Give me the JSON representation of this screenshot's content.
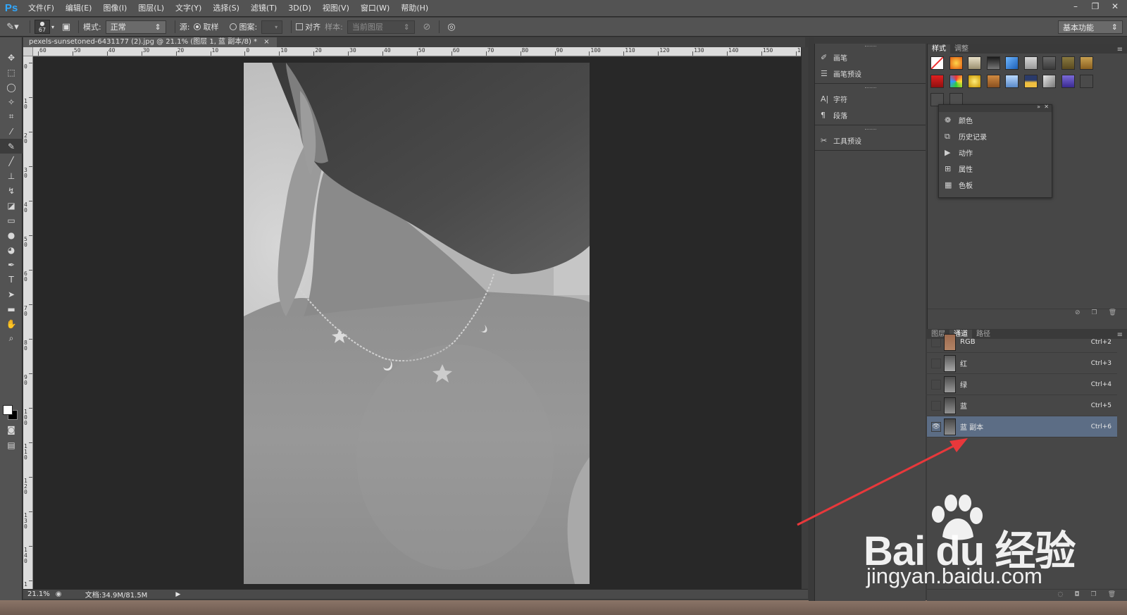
{
  "app": {
    "logo": "Ps"
  },
  "menu": [
    "文件(F)",
    "编辑(E)",
    "图像(I)",
    "图层(L)",
    "文字(Y)",
    "选择(S)",
    "滤镜(T)",
    "3D(D)",
    "视图(V)",
    "窗口(W)",
    "帮助(H)"
  ],
  "window_controls": {
    "minimize": "–",
    "restore": "❐",
    "close": "✕"
  },
  "options": {
    "brush_size": "67",
    "mode_label": "模式:",
    "mode_value": "正常",
    "source_label": "源:",
    "sampled_label": "取样",
    "pattern_label": "图案:",
    "aligned_label": "对齐",
    "sample_label": "样本:",
    "sample_value": "当前图层",
    "workspace": "基本功能"
  },
  "document": {
    "tab_title": "pexels-sunsetoned-6431177 (2).jpg @ 21.1% (图层 1, 蓝 副本/8) *",
    "close": "×",
    "ruler_h": [
      "60",
      "50",
      "40",
      "30",
      "20",
      "10",
      "0",
      "10",
      "20",
      "30",
      "40",
      "50",
      "60",
      "70",
      "80",
      "90",
      "100",
      "110",
      "120",
      "130",
      "140",
      "150",
      "1"
    ],
    "ruler_v": [
      "0",
      "10",
      "20",
      "30",
      "40",
      "50",
      "60",
      "70",
      "80",
      "90",
      "100",
      "110",
      "120",
      "130",
      "140",
      "1"
    ]
  },
  "status": {
    "zoom": "21.1%",
    "doc_info": "文档:34.9M/81.5M"
  },
  "mid_panel": {
    "items": [
      {
        "label": "画笔",
        "icon": "brush-icon"
      },
      {
        "label": "画笔预设",
        "icon": "brush-preset-icon"
      },
      {
        "label": "字符",
        "icon": "character-icon"
      },
      {
        "label": "段落",
        "icon": "paragraph-icon"
      },
      {
        "label": "工具预设",
        "icon": "tool-preset-icon"
      }
    ]
  },
  "styles_panel": {
    "tabs": [
      "样式",
      "调整"
    ],
    "active": 0
  },
  "float_panel": {
    "items": [
      {
        "label": "颜色",
        "icon": "color-icon"
      },
      {
        "label": "历史记录",
        "icon": "history-icon"
      },
      {
        "label": "动作",
        "icon": "actions-icon"
      },
      {
        "label": "属性",
        "icon": "properties-icon"
      },
      {
        "label": "色板",
        "icon": "swatches-icon"
      }
    ]
  },
  "channels_panel": {
    "tabs": [
      "图层",
      "通道",
      "路径"
    ],
    "active": 1,
    "rows": [
      {
        "name": "RGB",
        "shortcut": "Ctrl+2",
        "visible": false,
        "selected": false
      },
      {
        "name": "红",
        "shortcut": "Ctrl+3",
        "visible": false,
        "selected": false
      },
      {
        "name": "绿",
        "shortcut": "Ctrl+4",
        "visible": false,
        "selected": false
      },
      {
        "name": "蓝",
        "shortcut": "Ctrl+5",
        "visible": false,
        "selected": false
      },
      {
        "name": "蓝 副本",
        "shortcut": "Ctrl+6",
        "visible": true,
        "selected": true
      }
    ]
  },
  "watermark": {
    "main": "Bai du 经验",
    "sub": "jingyan.baidu.com"
  },
  "colors": {
    "accent": "#31a8ff",
    "selection": "#5c6d85",
    "annotation_arrow": "#e8383b"
  }
}
